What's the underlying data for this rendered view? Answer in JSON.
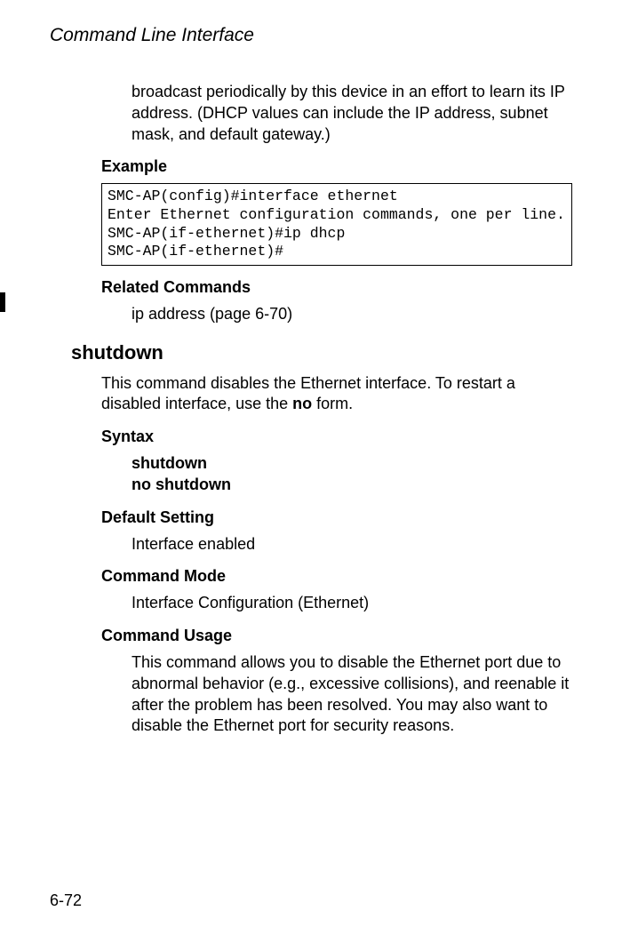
{
  "header": {
    "title": "Command Line Interface"
  },
  "intro": {
    "text": "broadcast periodically by this device in an effort to learn its IP address. (DHCP values can include the IP address, subnet mask, and default gateway.)"
  },
  "example": {
    "label": "Example",
    "code": "SMC-AP(config)#interface ethernet\nEnter Ethernet configuration commands, one per line.\nSMC-AP(if-ethernet)#ip dhcp\nSMC-AP(if-ethernet)#"
  },
  "related": {
    "label": "Related Commands",
    "text": "ip address (page 6-70)"
  },
  "command": {
    "name": "shutdown",
    "description_pre": "This command disables the Ethernet interface. To restart a disabled interface, use the ",
    "description_bold": "no",
    "description_post": " form."
  },
  "syntax": {
    "label": "Syntax",
    "line1": "shutdown",
    "line2": "no shutdown"
  },
  "default_setting": {
    "label": "Default Setting",
    "text": "Interface enabled"
  },
  "command_mode": {
    "label": "Command Mode",
    "text": "Interface Configuration (Ethernet)"
  },
  "command_usage": {
    "label": "Command Usage",
    "text": "This command allows you to disable the Ethernet port due to abnormal behavior (e.g., excessive collisions), and reenable it after the problem has been resolved. You may also want to disable the Ethernet port for security reasons."
  },
  "footer": {
    "page": "6-72"
  }
}
